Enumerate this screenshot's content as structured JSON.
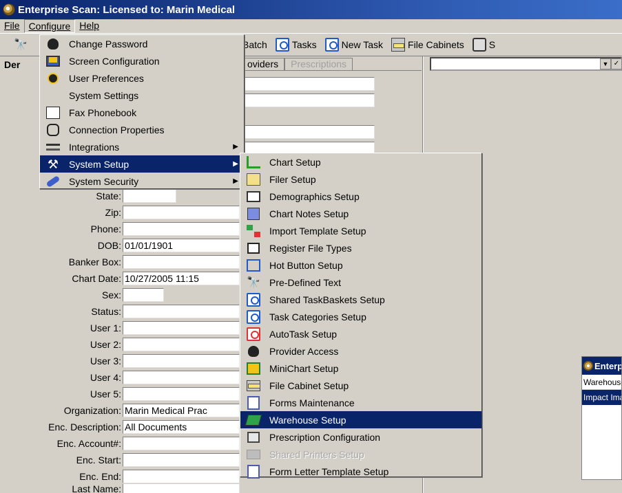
{
  "window": {
    "title": "Enterprise Scan: Licensed to: Marin Medical"
  },
  "menubar": {
    "file": "File",
    "configure": "Configure",
    "help": "Help"
  },
  "toolbar": {
    "batch": "Batch",
    "tasks": "Tasks",
    "new_task": "New Task",
    "file_cabinets": "File Cabinets",
    "s": "S"
  },
  "left_panel": {
    "label": "Der",
    "tabs": [
      "oviders",
      "Prescriptions"
    ]
  },
  "fields": {
    "state": {
      "label": "State:",
      "value": ""
    },
    "zip": {
      "label": "Zip:",
      "value": ""
    },
    "phone": {
      "label": "Phone:",
      "value": ""
    },
    "dob": {
      "label": "DOB:",
      "value": "01/01/1901"
    },
    "banker_box": {
      "label": "Banker Box:",
      "value": ""
    },
    "chart_date": {
      "label": "Chart Date:",
      "value": "10/27/2005 11:15"
    },
    "sex": {
      "label": "Sex:",
      "value": ""
    },
    "status": {
      "label": "Status:",
      "value": ""
    },
    "user1": {
      "label": "User 1:",
      "value": ""
    },
    "user2": {
      "label": "User 2:",
      "value": ""
    },
    "user3": {
      "label": "User 3:",
      "value": ""
    },
    "user4": {
      "label": "User 4:",
      "value": ""
    },
    "user5": {
      "label": "User 5:",
      "value": ""
    },
    "organization": {
      "label": "Organization:",
      "value": "Marin Medical Prac"
    },
    "enc_description": {
      "label": "Enc. Description:",
      "value": "All Documents"
    },
    "enc_account": {
      "label": "Enc. Account#:",
      "value": ""
    },
    "enc_start": {
      "label": "Enc. Start:",
      "value": ""
    },
    "enc_end": {
      "label": "Enc. End:",
      "value": ""
    },
    "last_name": {
      "label": "Last Name:",
      "value": ""
    }
  },
  "configure_menu": {
    "items": [
      {
        "label": "Change Password",
        "icon": "password-icon"
      },
      {
        "label": "Screen Configuration",
        "icon": "screen-config-icon"
      },
      {
        "label": "User Preferences",
        "icon": "user-preferences-icon"
      },
      {
        "label": "System Settings",
        "icon": ""
      },
      {
        "label": "Fax Phonebook",
        "icon": "fax-phonebook-icon"
      },
      {
        "label": "Connection Properties",
        "icon": "connection-icon"
      },
      {
        "label": "Integrations",
        "icon": "integrations-icon"
      },
      {
        "label": "System Setup",
        "icon": "tools-icon"
      },
      {
        "label": "System Security",
        "icon": "key-icon"
      }
    ]
  },
  "system_setup_menu": {
    "items": [
      {
        "label": "Chart Setup",
        "icon": "chart-setup-icon"
      },
      {
        "label": "Filer Setup",
        "icon": "filer-setup-icon"
      },
      {
        "label": "Demographics Setup",
        "icon": "demographics-icon"
      },
      {
        "label": "Chart Notes Setup",
        "icon": "chart-notes-icon"
      },
      {
        "label": "Import Template Setup",
        "icon": "import-template-icon"
      },
      {
        "label": "Register File Types",
        "icon": "register-file-icon"
      },
      {
        "label": "Hot Button Setup",
        "icon": "hot-button-icon"
      },
      {
        "label": "Pre-Defined Text",
        "icon": "binoculars-icon"
      },
      {
        "label": "Shared TaskBaskets Setup",
        "icon": "task-icon"
      },
      {
        "label": "Task Categories Setup",
        "icon": "task-icon"
      },
      {
        "label": "AutoTask Setup",
        "icon": "autotask-icon"
      },
      {
        "label": "Provider Access",
        "icon": "provider-icon"
      },
      {
        "label": "MiniChart Setup",
        "icon": "minichart-icon"
      },
      {
        "label": "File Cabinet Setup",
        "icon": "file-cabinet-icon"
      },
      {
        "label": "Forms Maintenance",
        "icon": "forms-icon"
      },
      {
        "label": "Warehouse Setup",
        "icon": "warehouse-icon"
      },
      {
        "label": "Prescription Configuration",
        "icon": "prescription-icon"
      },
      {
        "label": "Shared Printers Setup",
        "icon": "printer-icon"
      },
      {
        "label": "Form Letter Template Setup",
        "icon": "form-letter-icon"
      }
    ]
  },
  "mini_window": {
    "title": "Enterp",
    "rows": [
      "Warehouse",
      "Impact Ima"
    ]
  }
}
